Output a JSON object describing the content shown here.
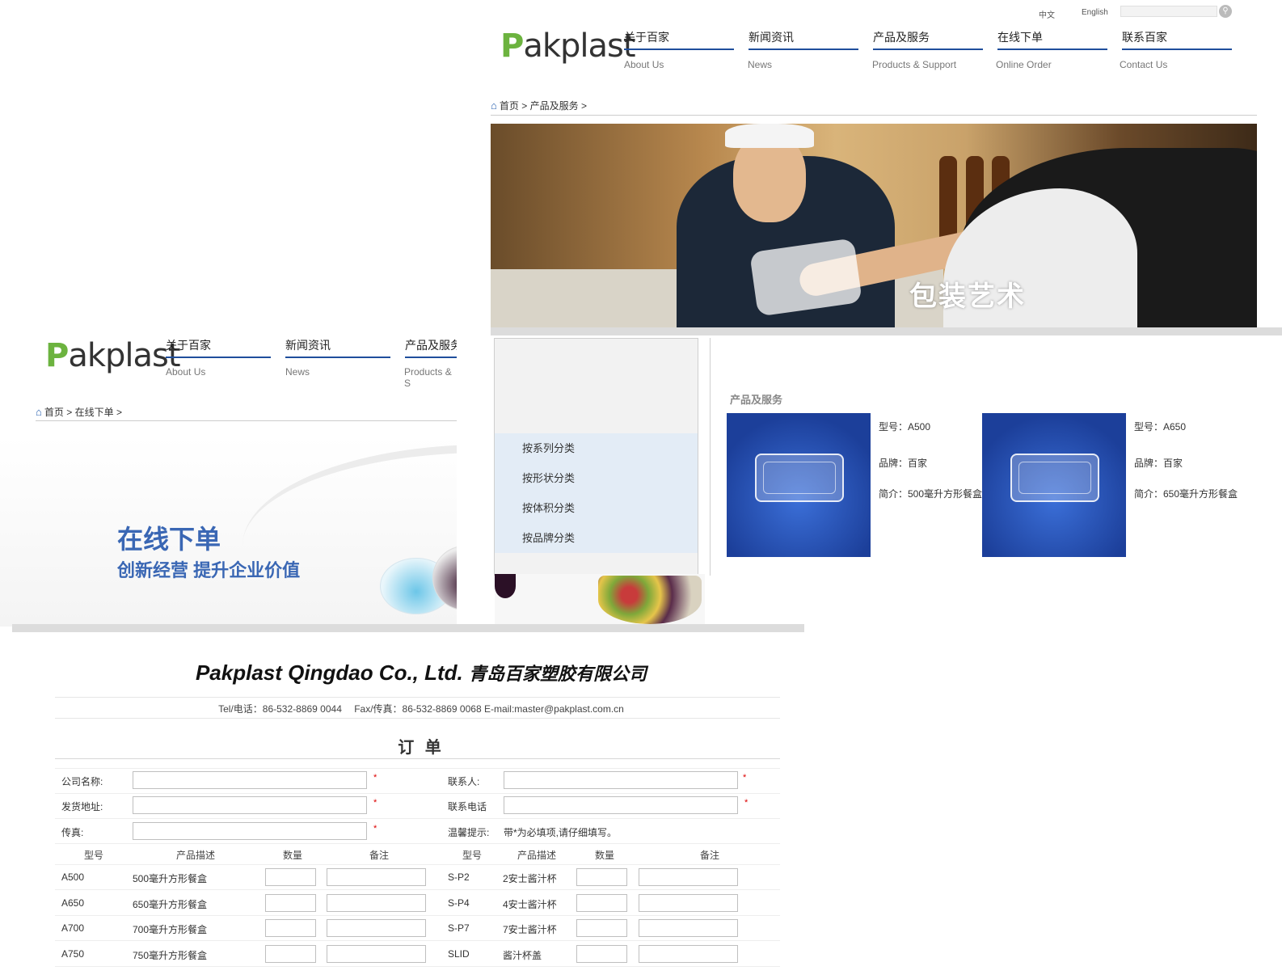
{
  "siteA": {
    "logo": {
      "p": "P",
      "rest": "akplast"
    },
    "lang": {
      "zh": "中文",
      "en": "English"
    },
    "nav": [
      {
        "cn": "关于百家",
        "en": "About Us"
      },
      {
        "cn": "新闻资讯",
        "en": "News"
      },
      {
        "cn": "产品及服务",
        "en": "Products & Support"
      },
      {
        "cn": "在线下单",
        "en": "Online Order"
      },
      {
        "cn": "联系百家",
        "en": "Contact Us"
      }
    ],
    "breadcrumb": {
      "home": "首页",
      "sep": ">",
      "current": "产品及服务",
      "end": ">"
    },
    "banner_title": "包装艺术",
    "side_menu": [
      "按系列分类",
      "按形状分类",
      "按体积分类",
      "按品牌分类"
    ],
    "section_title": "产品及服务",
    "products": [
      {
        "model": "型号：A500",
        "brand": "品牌：百家",
        "desc": "简介：500毫升方形餐盒"
      },
      {
        "model": "型号：A650",
        "brand": "品牌：百家",
        "desc": "简介：650毫升方形餐盒"
      }
    ]
  },
  "siteB": {
    "logo": {
      "p": "P",
      "rest": "akplast"
    },
    "nav": [
      {
        "cn": "关于百家",
        "en": "About Us"
      },
      {
        "cn": "新闻资讯",
        "en": "News"
      },
      {
        "cn": "产品及服务",
        "en": "Products & S"
      }
    ],
    "breadcrumb": {
      "home": "首页",
      "sep": ">",
      "current": "在线下单",
      "end": ">"
    },
    "banner_title": "在线下单",
    "banner_sub": "创新经营  提升企业价值"
  },
  "order": {
    "company_en": "Pakplast Qingdao Co., Ltd.",
    "company_cn": "青岛百家塑胶有限公司",
    "contact": "Tel/电话：86-532-8869 0044　 Fax/传真：86-532-8869 0068 E-mail:master@pakplast.com.cn",
    "form_title": "订 单",
    "fields": {
      "company": "公司名称:",
      "contact_person": "联系人:",
      "address": "发货地址:",
      "phone": "联系电话",
      "fax": "传真:",
      "tip_label": "温馨提示:",
      "tip_text": "带*为必填项,请仔细填写。"
    },
    "required_mark": "*",
    "columns": [
      "型号",
      "产品描述",
      "数量",
      "备注"
    ],
    "rows_left": [
      {
        "model": "A500",
        "desc": "500毫升方形餐盒"
      },
      {
        "model": "A650",
        "desc": "650毫升方形餐盒"
      },
      {
        "model": "A700",
        "desc": "700毫升方形餐盒"
      },
      {
        "model": "A750",
        "desc": "750毫升方形餐盒"
      }
    ],
    "rows_right": [
      {
        "model": "S-P2",
        "desc": "2安士酱汁杯"
      },
      {
        "model": "S-P4",
        "desc": "4安士酱汁杯"
      },
      {
        "model": "S-P7",
        "desc": "7安士酱汁杯"
      },
      {
        "model": "SLID",
        "desc": "酱汁杯盖"
      }
    ]
  }
}
